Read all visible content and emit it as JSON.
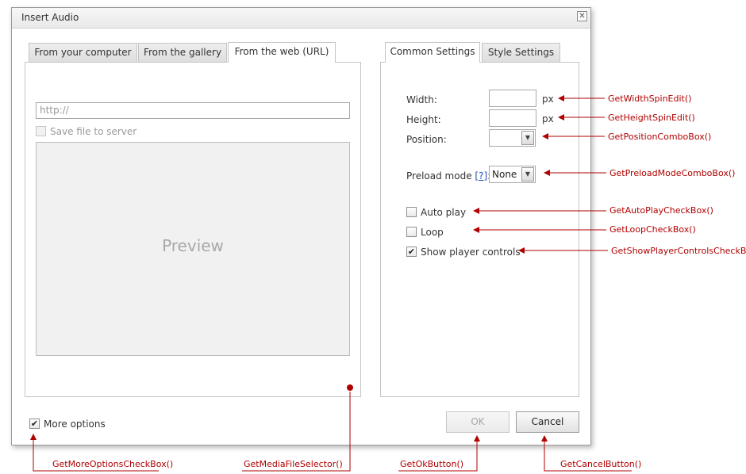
{
  "dialog": {
    "title": "Insert Audio"
  },
  "left_tabs": [
    {
      "label": "From your computer",
      "active": false
    },
    {
      "label": "From the gallery",
      "active": false
    },
    {
      "label": "From the web (URL)",
      "active": true
    }
  ],
  "right_tabs": [
    {
      "label": "Common Settings",
      "active": true
    },
    {
      "label": "Style Settings",
      "active": false
    }
  ],
  "url_panel": {
    "url_placeholder": "http://",
    "save_to_server_label": "Save file to server",
    "save_to_server_checked": false,
    "preview_text": "Preview"
  },
  "settings": {
    "width_label": "Width:",
    "width_value": "",
    "width_unit": "px",
    "height_label": "Height:",
    "height_value": "",
    "height_unit": "px",
    "position_label": "Position:",
    "position_value": "",
    "preload_label": "Preload mode",
    "preload_help": "[?]",
    "preload_colon": ":",
    "preload_value": "None",
    "auto_play_label": "Auto play",
    "auto_play_checked": false,
    "loop_label": "Loop",
    "loop_checked": false,
    "show_controls_label": "Show player controls",
    "show_controls_checked": true
  },
  "footer": {
    "more_options_label": "More options",
    "more_options_checked": true,
    "ok_label": "OK",
    "cancel_label": "Cancel"
  },
  "annotations": {
    "width_spin": "GetWidthSpinEdit()",
    "height_spin": "GetHeightSpinEdit()",
    "position_combo": "GetPositionComboBox()",
    "preload_combo": "GetPreloadModeComboBox()",
    "auto_play": "GetAutoPlayCheckBox()",
    "loop": "GetLoopCheckBox()",
    "show_controls": "GetShowPlayerControlsCheckBox()",
    "more_options": "GetMoreOptionsCheckBox()",
    "media_selector": "GetMediaFileSelector()",
    "ok_button": "GetOkButton()",
    "cancel_button": "GetCancelButton()"
  },
  "colors": {
    "annotation": "#b00000",
    "link": "#1f4fb5",
    "preview_bg": "#f1f1f1"
  },
  "icons": {
    "close": "close-icon",
    "dropdown": "chevron-down-icon",
    "check": "checkmark-icon"
  }
}
